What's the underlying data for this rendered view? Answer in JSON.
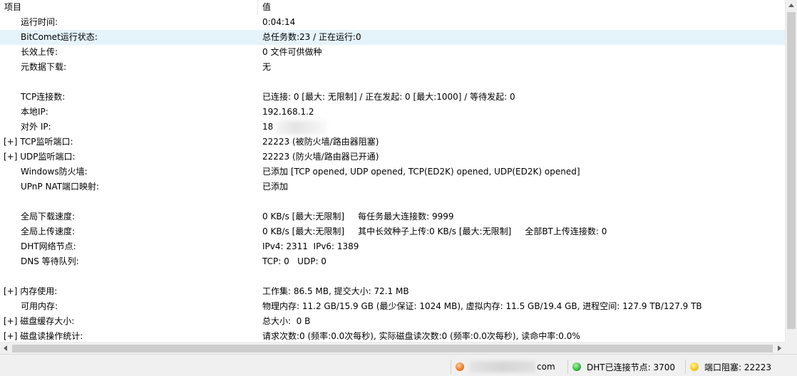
{
  "header": {
    "col1": "项目",
    "col2": "值"
  },
  "rows": [
    {
      "name": "运行时间:",
      "value": "0:04:14",
      "expand": ""
    },
    {
      "name": "BitComet运行状态:",
      "value": "总任务数:23 / 正在运行:0",
      "expand": "",
      "selected": true
    },
    {
      "name": "长效上传:",
      "value": "0 文件可供做种",
      "expand": ""
    },
    {
      "name": "元数据下载:",
      "value": "无",
      "expand": ""
    },
    {
      "name": "",
      "value": "",
      "expand": ""
    },
    {
      "name": "TCP连接数:",
      "value": "已连接: 0 [最大: 无限制] / 正在发起: 0 [最大:1000] / 等待发起: 0",
      "expand": ""
    },
    {
      "name": "本地IP:",
      "value": "192.168.1.2",
      "expand": ""
    },
    {
      "name": "对外 IP:",
      "value": "18",
      "expand": "",
      "blurred": true
    },
    {
      "name": "TCP监听端口:",
      "value": "22223 (被防火墙/路由器阻塞)",
      "expand": "[+] "
    },
    {
      "name": "UDP监听端口:",
      "value": "22223 (防火墙/路由器已开通)",
      "expand": "[+] "
    },
    {
      "name": "Windows防火墙:",
      "value": "已添加 [TCP opened, UDP opened, TCP(ED2K) opened, UDP(ED2K) opened]",
      "expand": ""
    },
    {
      "name": "UPnP NAT端口映射:",
      "value": "已添加",
      "expand": ""
    },
    {
      "name": "",
      "value": "",
      "expand": ""
    },
    {
      "name": "全局下载速度:",
      "value": "0 KB/s [最大:无限制]     每任务最大连接数: 9999",
      "expand": ""
    },
    {
      "name": "全局上传速度:",
      "value": "0 KB/s [最大:无限制]     其中长效种子上传:0 KB/s [最大:无限制]     全部BT上传连接数: 0",
      "expand": ""
    },
    {
      "name": "DHT网络节点:",
      "value": "IPv4: 2311  IPv6: 1389",
      "expand": ""
    },
    {
      "name": "DNS 等待队列:",
      "value": "TCP: 0   UDP: 0",
      "expand": ""
    },
    {
      "name": "",
      "value": "",
      "expand": ""
    },
    {
      "name": "内存使用:",
      "value": "工作集: 86.5 MB, 提交大小: 72.1 MB",
      "expand": "[+] "
    },
    {
      "name": "可用内存:",
      "value": "物理内存: 11.2 GB/15.9 GB (最少保证: 1024 MB), 虚拟内存: 11.5 GB/19.4 GB, 进程空间: 127.9 TB/127.9 TB",
      "expand": ""
    },
    {
      "name": "磁盘缓存大小:",
      "value": "总大小:  0 B",
      "expand": "[+] "
    },
    {
      "name": "磁盘读操作统计:",
      "value": "请求次数:0 (频率:0.0次每秒), 实际磁盘读次数:0 (频率:0.0次每秒), 读命中率:0.0%",
      "expand": "[+] "
    }
  ],
  "status": {
    "domain_suffix": "com",
    "dht_label": "DHT已连接节点: 3700",
    "port_label": "端口阻塞: 22223"
  }
}
